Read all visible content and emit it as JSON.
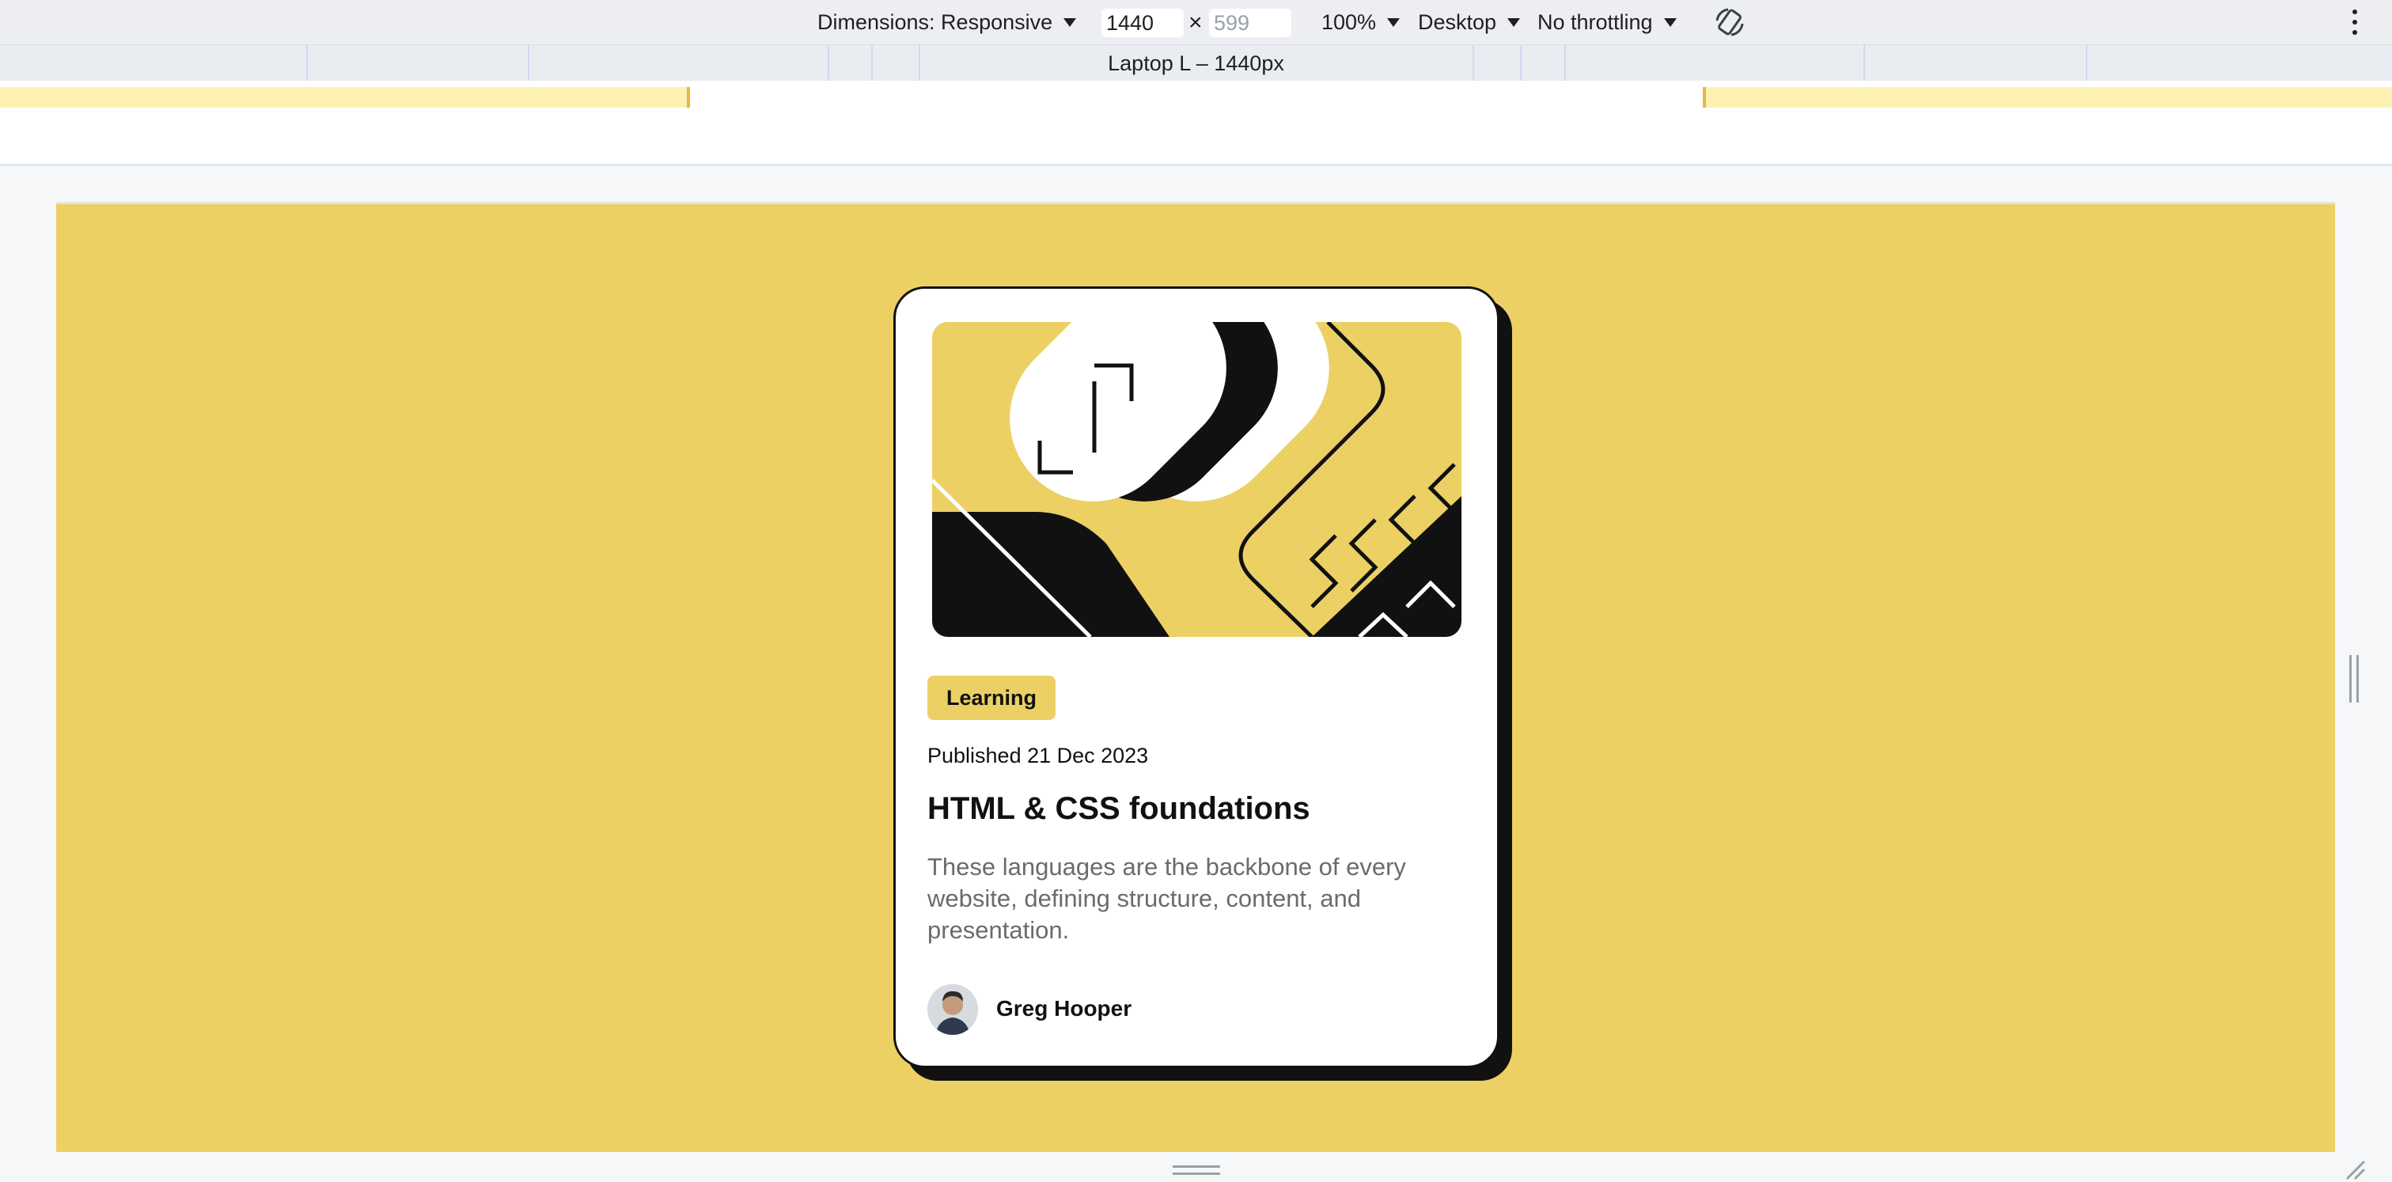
{
  "devtools": {
    "dimensions_label": "Dimensions: Responsive",
    "width_value": "1440",
    "height_placeholder": "599",
    "times": "×",
    "zoom": "100%",
    "device_type": "Desktop",
    "throttling": "No throttling",
    "media_query_label": "Laptop L – 1440px"
  },
  "card": {
    "tag": "Learning",
    "published": "Published 21 Dec 2023",
    "title": "HTML & CSS foundations",
    "description": "These languages are the backbone of every website, defining structure, content, and presentation.",
    "author": "Greg Hooper"
  },
  "colors": {
    "page_background": "#ecd064",
    "card_background": "#ffffff",
    "ink": "#111111",
    "muted_text": "#6b6b6b"
  },
  "icons": {
    "rotate": "rotate-icon",
    "menu": "kebab-menu-icon"
  }
}
